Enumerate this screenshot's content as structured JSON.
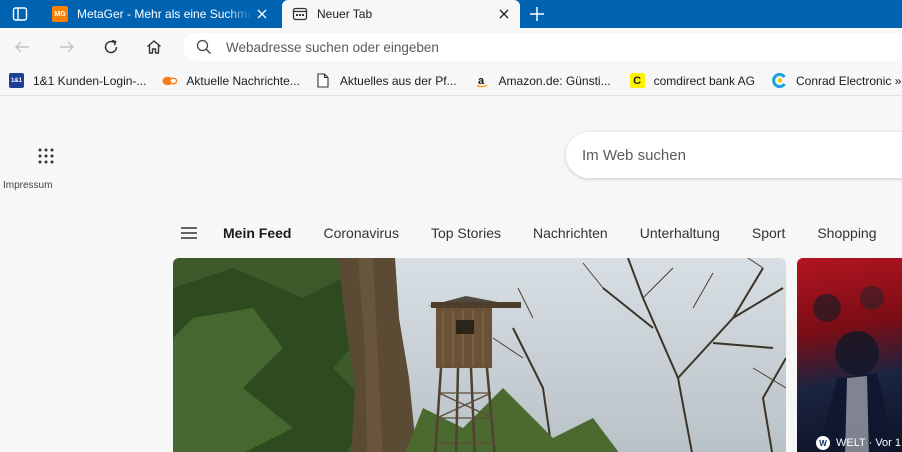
{
  "tabs": [
    {
      "title": "MetaGer - Mehr als eine Suchmaschine",
      "favicon": "MG",
      "active": false
    },
    {
      "title": "Neuer Tab",
      "favicon": "new-tab-page-icon",
      "active": true
    }
  ],
  "addressbar": {
    "placeholder": "Webadresse suchen oder eingeben"
  },
  "bookmarks": [
    {
      "label": "1&1 Kunden-Login-...",
      "favicon_text": "1&1"
    },
    {
      "label": "Aktuelle Nachrichte...",
      "favicon": "zdf-icon"
    },
    {
      "label": "Aktuelles aus der Pf...",
      "favicon": "document-icon"
    },
    {
      "label": "Amazon.de: Günsti...",
      "favicon": "amazon-icon"
    },
    {
      "label": "comdirect bank AG",
      "favicon_text": "C"
    },
    {
      "label": "Conrad Electronic »...",
      "favicon": "conrad-icon"
    }
  ],
  "newtab": {
    "impressum": "Impressum",
    "search_placeholder": "Im Web suchen",
    "feed_tabs": [
      "Mein Feed",
      "Coronavirus",
      "Top Stories",
      "Nachrichten",
      "Unterhaltung",
      "Sport",
      "Shopping"
    ],
    "side_card": {
      "badge": "W",
      "source": "WELT · Vor 1"
    }
  },
  "colors": {
    "tabstrip": "#0063b1",
    "page_bg": "#f7f7f7",
    "accent": "#0063b1"
  }
}
